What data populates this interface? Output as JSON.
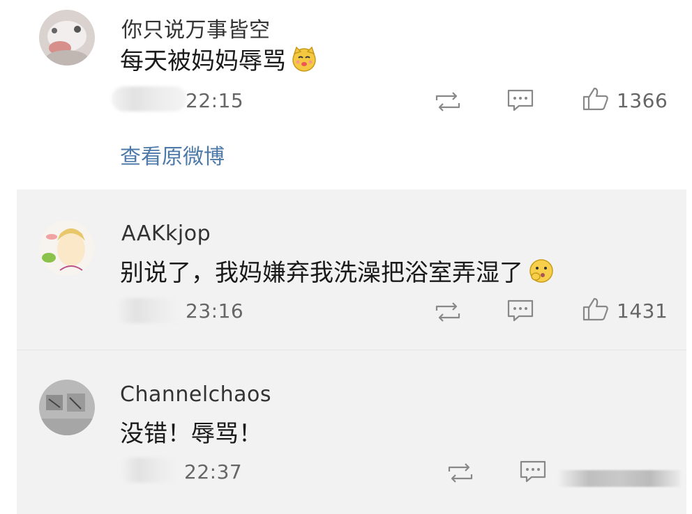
{
  "comments": [
    {
      "username": "你只说万事皆空",
      "text": "每天被妈妈辱骂",
      "time": "22:15",
      "likes": "1366",
      "view_original_link": "查看原微博"
    },
    {
      "username": "AAKkjop",
      "text": "别说了，我妈嫌弃我洗澡把浴室弄湿了",
      "time": "23:16",
      "likes": "1431"
    },
    {
      "username": "Channelchaos",
      "text": "没错！辱骂！",
      "time": "22:37"
    }
  ],
  "colors": {
    "link": "#4d7aa8",
    "icon": "#888888",
    "card_background": "#f2f2f2"
  },
  "icons": [
    "repost-icon",
    "comment-icon",
    "like-icon",
    "cat-emoji-icon",
    "hand-cheek-emoji-icon"
  ]
}
